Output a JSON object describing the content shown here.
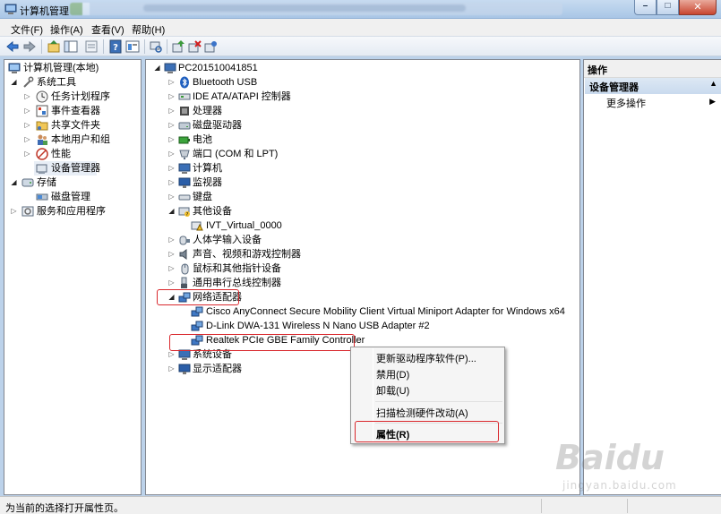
{
  "window": {
    "title": "计算机管理"
  },
  "menubar": {
    "items": [
      "文件(F)",
      "操作(A)",
      "查看(V)",
      "帮助(H)"
    ]
  },
  "toolbar": {
    "icons": [
      "back-icon",
      "forward-icon",
      "up-icon",
      "show-tree-icon",
      "properties-icon",
      "help-icon",
      "view-icon",
      "scan-icon",
      "update-driver-icon",
      "disable-icon",
      "uninstall-icon"
    ]
  },
  "left_tree": {
    "root": "计算机管理(本地)",
    "system_tools": "系统工具",
    "task_scheduler": "任务计划程序",
    "event_viewer": "事件查看器",
    "shared_folders": "共享文件夹",
    "local_users": "本地用户和组",
    "performance": "性能",
    "device_manager": "设备管理器",
    "storage": "存储",
    "disk_management": "磁盘管理",
    "services": "服务和应用程序"
  },
  "device_tree": {
    "computer": "PC201510041851",
    "categories": [
      "Bluetooth USB",
      "IDE ATA/ATAPI 控制器",
      "处理器",
      "磁盘驱动器",
      "电池",
      "端口 (COM 和 LPT)",
      "计算机",
      "监视器",
      "键盘",
      "其他设备",
      "IVT_Virtual_0000",
      "人体学输入设备",
      "声音、视频和游戏控制器",
      "鼠标和其他指针设备",
      "通用串行总线控制器",
      "网络适配器",
      "Cisco AnyConnect Secure Mobility Client Virtual Miniport Adapter for Windows x64",
      "D-Link DWA-131 Wireless N Nano USB Adapter #2",
      "Realtek PCIe GBE Family Controller",
      "系统设备",
      "显示适配器"
    ]
  },
  "actions": {
    "header": "操作",
    "section": "设备管理器",
    "more": "更多操作"
  },
  "context_menu": {
    "update_driver": "更新驱动程序软件(P)...",
    "disable": "禁用(D)",
    "uninstall": "卸载(U)",
    "scan": "扫描检测硬件改动(A)",
    "properties": "属性(R)"
  },
  "status": {
    "text": "为当前的选择打开属性页。"
  },
  "watermark": {
    "brand": "Baidu",
    "sub": "jingyan.baidu.com"
  },
  "colors": {
    "highlight": "#d9282d",
    "selection_bg": "#e8eef6"
  }
}
